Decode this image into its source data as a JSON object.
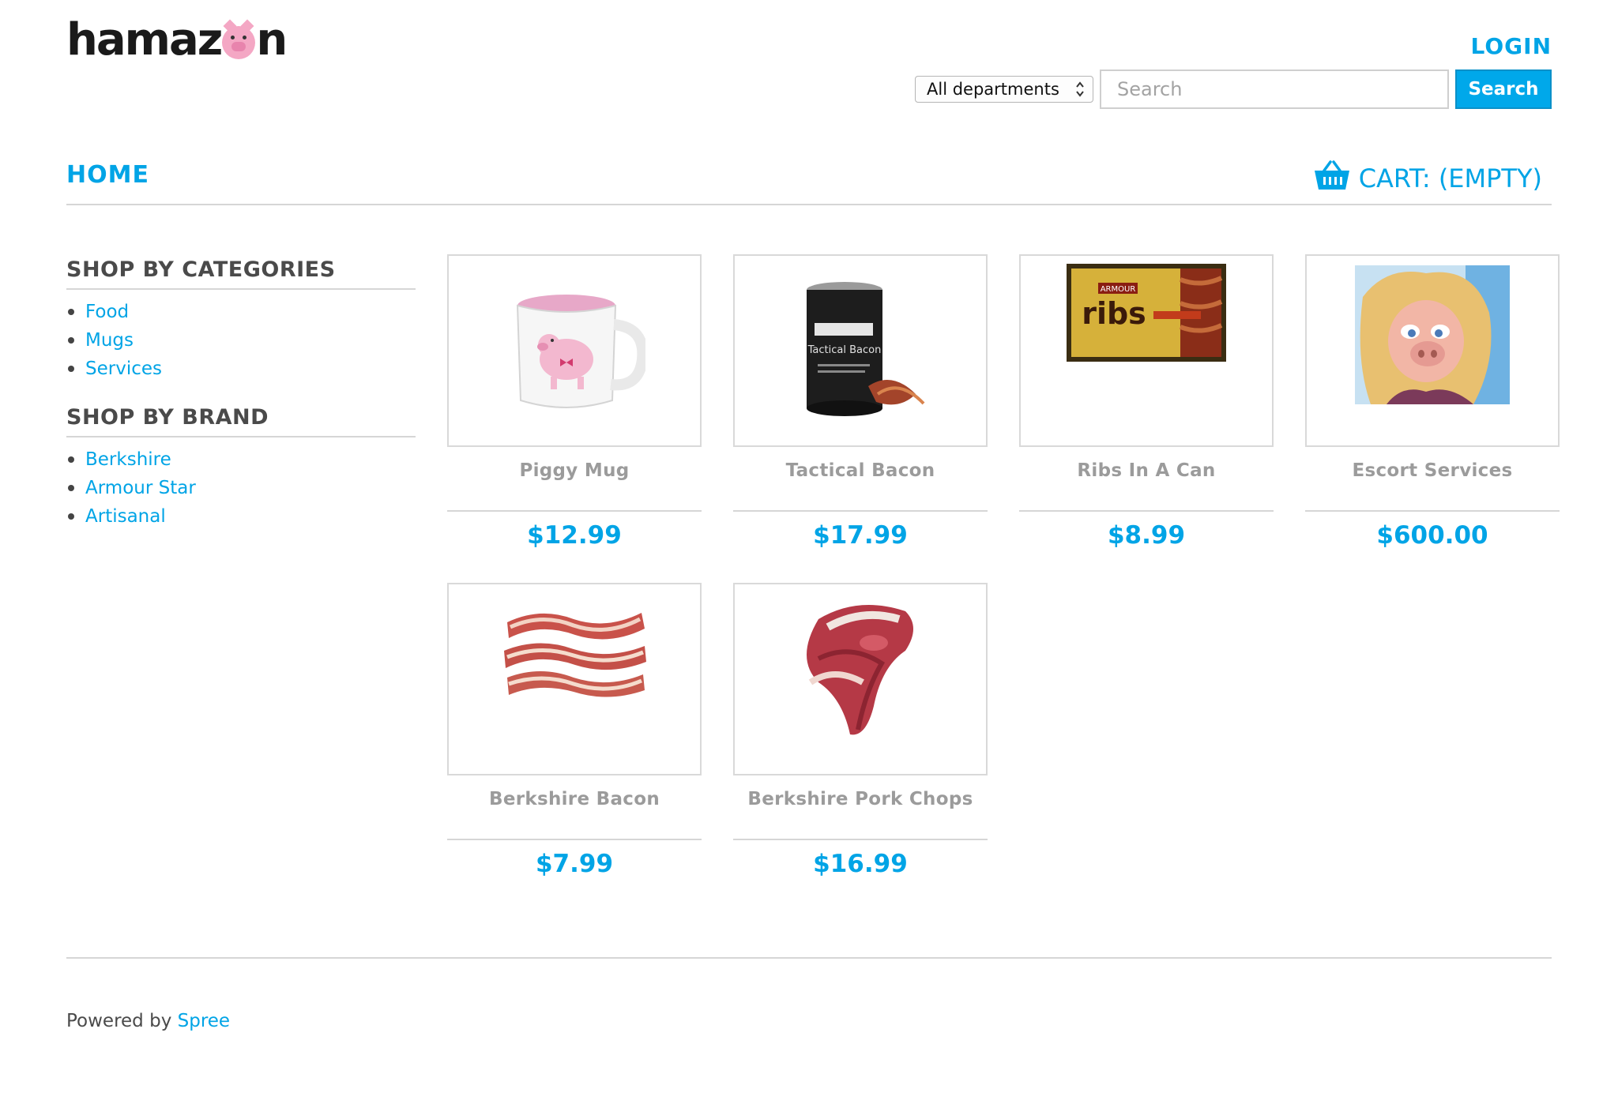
{
  "brand": {
    "logo_left": "hamaz",
    "logo_right": "n"
  },
  "header": {
    "login_label": "LOGIN",
    "department_selected": "All departments",
    "search_placeholder": "Search",
    "search_button_label": "Search"
  },
  "nav": {
    "home_label": "HOME",
    "cart_label": "CART: (EMPTY)"
  },
  "sidebar": {
    "categories_title": "SHOP BY CATEGORIES",
    "categories": [
      {
        "label": "Food"
      },
      {
        "label": "Mugs"
      },
      {
        "label": "Services"
      }
    ],
    "brand_title": "SHOP BY BRAND",
    "brands": [
      {
        "label": "Berkshire"
      },
      {
        "label": "Armour Star"
      },
      {
        "label": "Artisanal"
      }
    ]
  },
  "products": [
    {
      "name": "Piggy Mug",
      "price": "$12.99",
      "image": "pig-mug-image"
    },
    {
      "name": "Tactical Bacon",
      "price": "$17.99",
      "image": "bacon-can-image"
    },
    {
      "name": "Ribs In A Can",
      "price": "$8.99",
      "image": "ribs-can-image"
    },
    {
      "name": "Escort Services",
      "price": "$600.00",
      "image": "miss-piggy-image"
    },
    {
      "name": "Berkshire Bacon",
      "price": "$7.99",
      "image": "bacon-strips-image"
    },
    {
      "name": "Berkshire Pork Chops",
      "price": "$16.99",
      "image": "pork-chops-image"
    }
  ],
  "footer": {
    "powered_by": "Powered by",
    "link_label": "Spree"
  },
  "colors": {
    "accent": "#00a4e6",
    "text": "#4a4a4a",
    "muted": "#9b9b9b",
    "border": "#d6d6d6"
  }
}
